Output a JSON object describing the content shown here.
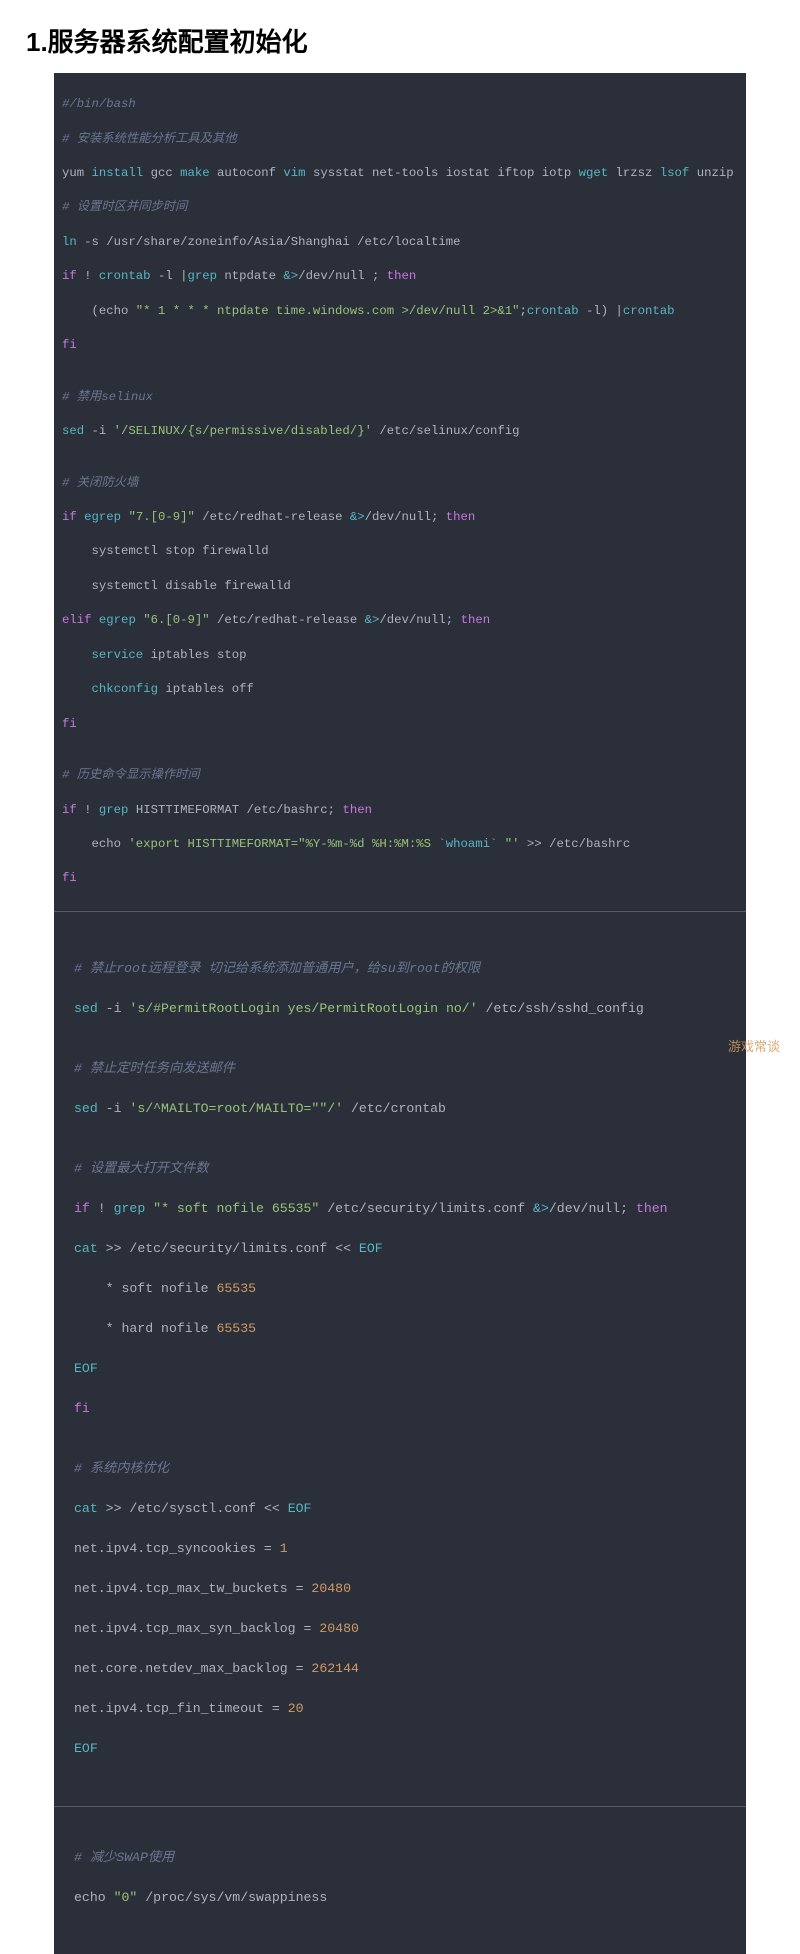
{
  "title": "1.服务器系统配置初始化",
  "watermark": "游戏常谈",
  "block1": {
    "l1": "#/bin/bash",
    "l2": "# 安装系统性能分析工具及其他",
    "l3a": "yum ",
    "l3b": "install",
    "l3c": " gcc ",
    "l3d": "make",
    "l3e": " autoconf ",
    "l3f": "vim",
    "l3g": " sysstat net-tools iostat iftop iotp ",
    "l3h": "wget",
    "l3i": " lrzsz ",
    "l3j": "lsof",
    "l3k": " unzip",
    "l4": "# 设置时区并同步时间",
    "l5a": "ln",
    "l5b": " -s /usr/share/zoneinfo/Asia/Shanghai /etc/localtime",
    "l6a": "if",
    "l6b": " ! ",
    "l6c": "crontab",
    "l6d": " -l |",
    "l6e": "grep",
    "l6f": " ntpdate ",
    "l6g": "&>",
    "l6h": "/dev/null ; ",
    "l6i": "then",
    "l7a": "    (echo ",
    "l7b": "\"* 1 * * * ntpdate time.windows.com >/dev/null 2>&1\"",
    "l7c": ";",
    "l7d": "crontab",
    "l7e": " -l) |",
    "l7f": "crontab",
    "l8": "fi",
    "l9": "",
    "l10": "# 禁用selinux",
    "l11a": "sed",
    "l11b": " -i ",
    "l11c": "'/SELINUX/{s/permissive/disabled/}'",
    "l11d": " /etc/selinux/config",
    "l12": "",
    "l13": "# 关闭防火墙",
    "l14a": "if",
    "l14b": " ",
    "l14c": "egrep",
    "l14d": " ",
    "l14e": "\"7.[0-9]\"",
    "l14f": " /etc/redhat-release ",
    "l14g": "&>",
    "l14h": "/dev/null; ",
    "l14i": "then",
    "l15": "    systemctl stop firewalld",
    "l16": "    systemctl disable firewalld",
    "l17a": "elif",
    "l17b": " ",
    "l17c": "egrep",
    "l17d": " ",
    "l17e": "\"6.[0-9]\"",
    "l17f": " /etc/redhat-release ",
    "l17g": "&>",
    "l17h": "/dev/null; ",
    "l17i": "then",
    "l18a": "    ",
    "l18b": "service",
    "l18c": " iptables stop",
    "l19a": "    ",
    "l19b": "chkconfig",
    "l19c": " iptables off",
    "l20": "fi",
    "l21": "",
    "l22": "# 历史命令显示操作时间",
    "l23a": "if",
    "l23b": " ! ",
    "l23c": "grep",
    "l23d": " HISTTIMEFORMAT /etc/bashrc; ",
    "l23e": "then",
    "l24a": "    echo ",
    "l24b": "'export HISTTIMEFORMAT=\"%Y-%m-%d %H:%M:%S ",
    "l24c": "`whoami`",
    "l24d": " \"'",
    "l24e": " >> /etc/bashrc",
    "l25": "fi"
  },
  "block2": {
    "l1": "# 禁止root远程登录 切记给系统添加普通用户，给su到root的权限",
    "l2a": "sed",
    "l2b": " -i ",
    "l2c": "'s/#PermitRootLogin yes/PermitRootLogin no/'",
    "l2d": " /etc/ssh/sshd_config",
    "l3": "",
    "l4": "# 禁止定时任务向发送邮件",
    "l5a": "sed",
    "l5b": " -i ",
    "l5c": "'s/^MAILTO=root/MAILTO=\"\"/'",
    "l5d": " /etc/crontab",
    "l6": "",
    "l7": "# 设置最大打开文件数",
    "l8a": "if",
    "l8b": " ! ",
    "l8c": "grep",
    "l8d": " ",
    "l8e": "\"* soft nofile 65535\"",
    "l8f": " /etc/security/limits.conf ",
    "l8g": "&>",
    "l8h": "/dev/null; ",
    "l8i": "then",
    "l9a": "cat",
    "l9b": " >> /etc/security/limits.conf << ",
    "l9c": "EOF",
    "l10a": "    * soft nofile ",
    "l10b": "65535",
    "l11a": "    * hard nofile ",
    "l11b": "65535",
    "l12": "EOF",
    "l13": "fi",
    "l14": "",
    "l15": "# 系统内核优化",
    "l16a": "cat",
    "l16b": " >> /etc/sysctl.conf << ",
    "l16c": "EOF",
    "l17a": "net.ipv4.tcp_syncookies = ",
    "l17b": "1",
    "l18a": "net.ipv4.tcp_max_tw_buckets = ",
    "l18b": "20480",
    "l19a": "net.ipv4.tcp_max_syn_backlog = ",
    "l19b": "20480",
    "l20a": "net.core.netdev_max_backlog = ",
    "l20b": "262144",
    "l21a": "net.ipv4.tcp_fin_timeout = ",
    "l21b": "20",
    "l22": "EOF"
  },
  "block3": {
    "l1": "# 减少SWAP使用",
    "l2a": "echo ",
    "l2b": "\"0\"",
    "l2c": " /proc/sys/vm/swappiness"
  }
}
